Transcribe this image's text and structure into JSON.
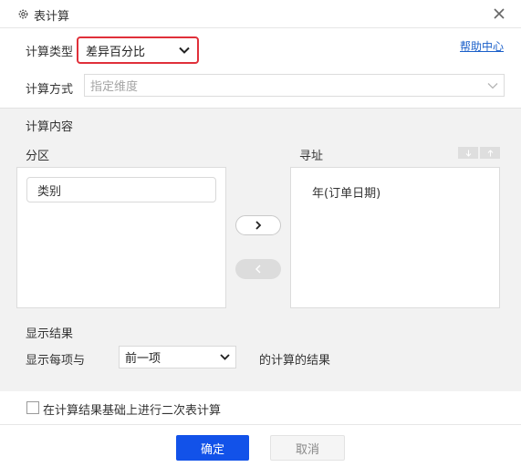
{
  "dialog": {
    "title": "表计算"
  },
  "calc_type": {
    "label": "计算类型",
    "value": "差异百分比"
  },
  "help_link": "帮助中心",
  "calc_method": {
    "label": "计算方式",
    "placeholder": "指定维度"
  },
  "calc_content": {
    "label": "计算内容",
    "partition": {
      "label": "分区",
      "items": [
        "类别"
      ]
    },
    "addressing": {
      "label": "寻址",
      "items": [
        "年(订单日期)"
      ]
    }
  },
  "result": {
    "section_label": "显示结果",
    "prefix": "显示每项与",
    "compare_option": "前一项",
    "suffix": "的计算的结果"
  },
  "secondary_calc": {
    "label": "在计算结果基础上进行二次表计算",
    "checked": false
  },
  "footer": {
    "ok_label": "确定",
    "cancel_label": "取消"
  },
  "colors": {
    "primary": "#1252e9",
    "highlight": "#e0303a",
    "link": "#1a5fc9",
    "panel": "#f2f2f2"
  }
}
